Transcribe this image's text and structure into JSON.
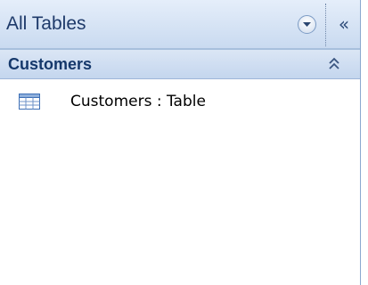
{
  "nav_pane": {
    "title": "All Tables",
    "collapse_glyph": "«",
    "dropdown_icon": "dropdown-circle-icon",
    "group": {
      "label": "Customers",
      "collapse_icon": "double-chevron-up-icon"
    },
    "items": [
      {
        "label": "Customers : Table",
        "icon": "table-icon"
      }
    ]
  },
  "colors": {
    "header_bg": "#c9daf0",
    "title_text": "#1e3a6a",
    "group_text": "#15386b"
  }
}
